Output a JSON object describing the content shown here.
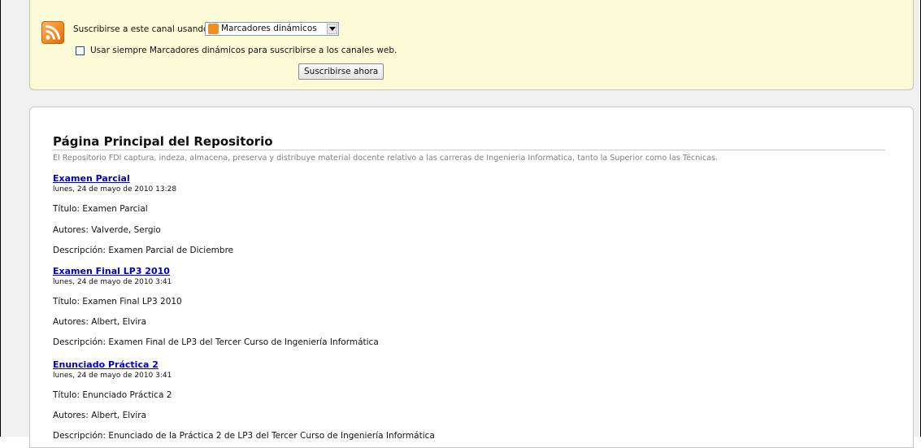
{
  "subscribe": {
    "label": "Suscribirse a este canal usando",
    "reader_selected": "Marcadores dinámicos",
    "always_use_label": "Usar siempre Marcadores dinámicos para suscribirse a los canales web.",
    "always_use_checked": false,
    "button_label": "Suscribirse ahora"
  },
  "feed": {
    "title": "Página Principal del Repositorio",
    "description": "El Repositorio FDI captura, indeza, almacena, preserva y distribuye material docente relativo a las carreras de Ingenieria Informatica, tanto la Superior como las Técnicas.",
    "entries": [
      {
        "title": "Examen Parcial",
        "date": "lunes, 24 de mayo de 2010 13:28",
        "titulo": "Título: Examen Parcial",
        "autores": "Autores: Valverde, Sergio",
        "descripcion": "Descripción: Examen Parcial de Diciembre"
      },
      {
        "title": "Examen Final LP3 2010",
        "date": "lunes, 24 de mayo de 2010 3:41",
        "titulo": "Título: Examen Final LP3 2010",
        "autores": "Autores: Albert, Elvira",
        "descripcion": "Descripción: Examen Final de LP3 del Tercer Curso de Ingeniería Informática"
      },
      {
        "title": "Enunciado Práctica 2",
        "date": "lunes, 24 de mayo de 2010 3:41",
        "titulo": "Título: Enunciado Práctica 2",
        "autores": "Autores: Albert, Elvira",
        "descripcion": "Descripción: Enunciado de la Práctica 2 de LP3 del Tercer Curso de Ingeniería Informática"
      }
    ]
  },
  "icons": {
    "feed": "rss-feed-icon",
    "dropdown": "chevron-down-icon"
  },
  "colors": {
    "subscribe_bg": "#fbfbd7",
    "link": "#0000cc",
    "feed_orange": "#f58c1f",
    "description_gray": "#808080"
  }
}
